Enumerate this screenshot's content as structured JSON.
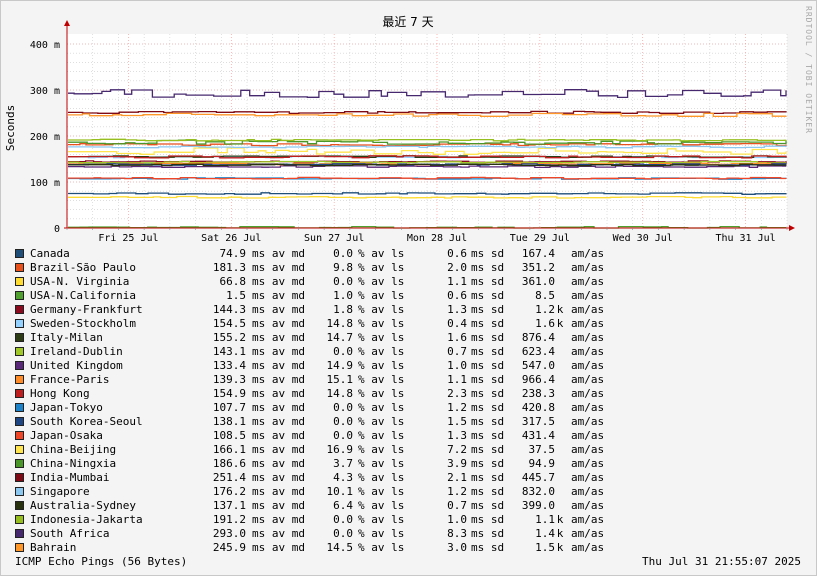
{
  "side_text": "RRDTOOL / TOBI OETIKER",
  "footer": {
    "left": "ICMP Echo Pings (56 Bytes)",
    "right": "Thu Jul 31 21:55:07 2025"
  },
  "colors": {
    "background": "#f4f4f4",
    "grid_major": "#ff8a8a",
    "grid_minor": "#cccccc",
    "axis": "#c00000"
  },
  "chart_data": {
    "type": "line",
    "title": "最近 7 天",
    "ylabel": "Seconds",
    "ylim": [
      0,
      0.4
    ],
    "y_ticks": [
      {
        "value": 0,
        "label": "0"
      },
      {
        "value": 0.1,
        "label": "100 m"
      },
      {
        "value": 0.2,
        "label": "200 m"
      },
      {
        "value": 0.3,
        "label": "300 m"
      },
      {
        "value": 0.4,
        "label": "400 m"
      }
    ],
    "x_ticks": [
      "Fri 25 Jul",
      "Sat 26 Jul",
      "Sun 27 Jul",
      "Mon 28 Jul",
      "Tue 29 Jul",
      "Wed 30 Jul",
      "Thu 31 Jul"
    ],
    "grid": true,
    "legend_placement": "bottom",
    "series": [
      {
        "name": "Canada",
        "color": "#1f4e79",
        "median": "74.9",
        "u1": "ms av md",
        "loss": "0.0",
        "u2": "% av ls",
        "sd": "0.6",
        "u3": "ms sd",
        "amas": "167.4",
        "k": "",
        "u5": "am/as"
      },
      {
        "name": "Brazil-São Paulo",
        "color": "#e8501c",
        "median": "181.3",
        "u1": "ms av md",
        "loss": "9.8",
        "u2": "% av ls",
        "sd": "2.0",
        "u3": "ms sd",
        "amas": "351.2",
        "k": "",
        "u5": "am/as"
      },
      {
        "name": "USA-N. Virginia",
        "color": "#ffdc32",
        "median": "66.8",
        "u1": "ms av md",
        "loss": "0.0",
        "u2": "% av ls",
        "sd": "1.1",
        "u3": "ms sd",
        "amas": "361.0",
        "k": "",
        "u5": "am/as"
      },
      {
        "name": "USA-N.California",
        "color": "#50a030",
        "median": "1.5",
        "u1": "ms av md",
        "loss": "1.0",
        "u2": "% av ls",
        "sd": "0.6",
        "u3": "ms sd",
        "amas": "8.5",
        "k": "",
        "u5": "am/as"
      },
      {
        "name": "Germany-Frankfurt",
        "color": "#8c0a1e",
        "median": "144.3",
        "u1": "ms av md",
        "loss": "1.8",
        "u2": "% av ls",
        "sd": "1.3",
        "u3": "ms sd",
        "amas": "1.2",
        "k": "k",
        "u5": "am/as"
      },
      {
        "name": "Sweden-Stockholm",
        "color": "#96d2ff",
        "median": "154.5",
        "u1": "ms av md",
        "loss": "14.8",
        "u2": "% av ls",
        "sd": "0.4",
        "u3": "ms sd",
        "amas": "1.6",
        "k": "k",
        "u5": "am/as"
      },
      {
        "name": "Italy-Milan",
        "color": "#2d3c14",
        "median": "155.2",
        "u1": "ms av md",
        "loss": "14.7",
        "u2": "% av ls",
        "sd": "1.6",
        "u3": "ms sd",
        "amas": "876.4",
        "k": "",
        "u5": "am/as"
      },
      {
        "name": "Ireland-Dublin",
        "color": "#a0c828",
        "median": "143.1",
        "u1": "ms av md",
        "loss": "0.0",
        "u2": "% av ls",
        "sd": "0.7",
        "u3": "ms sd",
        "amas": "623.4",
        "k": "",
        "u5": "am/as"
      },
      {
        "name": "United Kingdom",
        "color": "#5a2878",
        "median": "133.4",
        "u1": "ms av md",
        "loss": "14.9",
        "u2": "% av ls",
        "sd": "1.0",
        "u3": "ms sd",
        "amas": "547.0",
        "k": "",
        "u5": "am/as"
      },
      {
        "name": "France-Paris",
        "color": "#ff8c28",
        "median": "139.3",
        "u1": "ms av md",
        "loss": "15.1",
        "u2": "% av ls",
        "sd": "1.1",
        "u3": "ms sd",
        "amas": "966.4",
        "k": "",
        "u5": "am/as"
      },
      {
        "name": "Hong Kong",
        "color": "#be1e1e",
        "median": "154.9",
        "u1": "ms av md",
        "loss": "14.8",
        "u2": "% av ls",
        "sd": "2.3",
        "u3": "ms sd",
        "amas": "238.3",
        "k": "",
        "u5": "am/as"
      },
      {
        "name": "Japan-Tokyo",
        "color": "#1e82c8",
        "median": "107.7",
        "u1": "ms av md",
        "loss": "0.0",
        "u2": "% av ls",
        "sd": "1.2",
        "u3": "ms sd",
        "amas": "420.8",
        "k": "",
        "u5": "am/as"
      },
      {
        "name": "South Korea-Seoul",
        "color": "#1e4682",
        "median": "138.1",
        "u1": "ms av md",
        "loss": "0.0",
        "u2": "% av ls",
        "sd": "1.5",
        "u3": "ms sd",
        "amas": "317.5",
        "k": "",
        "u5": "am/as"
      },
      {
        "name": "Japan-Osaka",
        "color": "#f04628",
        "median": "108.5",
        "u1": "ms av md",
        "loss": "0.0",
        "u2": "% av ls",
        "sd": "1.3",
        "u3": "ms sd",
        "amas": "431.4",
        "k": "",
        "u5": "am/as"
      },
      {
        "name": "China-Beijing",
        "color": "#ffe650",
        "median": "166.1",
        "u1": "ms av md",
        "loss": "16.9",
        "u2": "% av ls",
        "sd": "7.2",
        "u3": "ms sd",
        "amas": "37.5",
        "k": "",
        "u5": "am/as"
      },
      {
        "name": "China-Ningxia",
        "color": "#4b9628",
        "median": "186.6",
        "u1": "ms av md",
        "loss": "3.7",
        "u2": "% av ls",
        "sd": "3.9",
        "u3": "ms sd",
        "amas": "94.9",
        "k": "",
        "u5": "am/as"
      },
      {
        "name": "India-Mumbai",
        "color": "#7d0a14",
        "median": "251.4",
        "u1": "ms av md",
        "loss": "4.3",
        "u2": "% av ls",
        "sd": "2.1",
        "u3": "ms sd",
        "amas": "445.7",
        "k": "",
        "u5": "am/as"
      },
      {
        "name": "Singapore",
        "color": "#8cc8f0",
        "median": "176.2",
        "u1": "ms av md",
        "loss": "10.1",
        "u2": "% av ls",
        "sd": "1.2",
        "u3": "ms sd",
        "amas": "832.0",
        "k": "",
        "u5": "am/as"
      },
      {
        "name": "Australia-Sydney",
        "color": "#28320f",
        "median": "137.1",
        "u1": "ms av md",
        "loss": "6.4",
        "u2": "% av ls",
        "sd": "0.7",
        "u3": "ms sd",
        "amas": "399.0",
        "k": "",
        "u5": "am/as"
      },
      {
        "name": "Indonesia-Jakarta",
        "color": "#96be1e",
        "median": "191.2",
        "u1": "ms av md",
        "loss": "0.0",
        "u2": "% av ls",
        "sd": "1.0",
        "u3": "ms sd",
        "amas": "1.1",
        "k": "k",
        "u5": "am/as"
      },
      {
        "name": "South Africa",
        "color": "#46286e",
        "median": "293.0",
        "u1": "ms av md",
        "loss": "0.0",
        "u2": "% av ls",
        "sd": "8.3",
        "u3": "ms sd",
        "amas": "1.4",
        "k": "k",
        "u5": "am/as"
      },
      {
        "name": "Bahrain",
        "color": "#ff9628",
        "median": "245.9",
        "u1": "ms av md",
        "loss": "14.5",
        "u2": "% av ls",
        "sd": "3.0",
        "u3": "ms sd",
        "amas": "1.5",
        "k": "k",
        "u5": "am/as"
      }
    ]
  }
}
